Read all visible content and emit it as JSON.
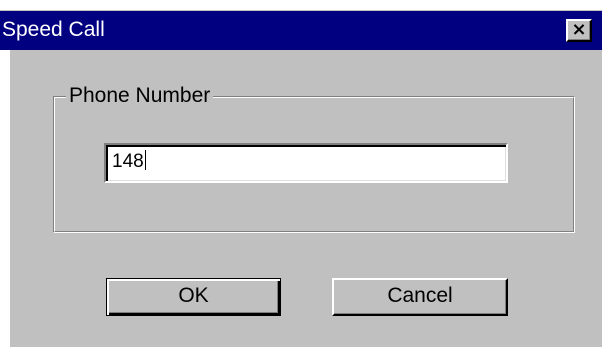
{
  "window": {
    "title": "Speed Call",
    "close_glyph": "×",
    "close_icon": "close-icon"
  },
  "phone_group": {
    "label": "Phone Number",
    "input_value": "148"
  },
  "buttons": {
    "ok_label": "OK",
    "cancel_label": "Cancel"
  },
  "colors": {
    "titlebar": "#000080",
    "face": "#c0c0c0",
    "title_text": "#ffffff"
  }
}
